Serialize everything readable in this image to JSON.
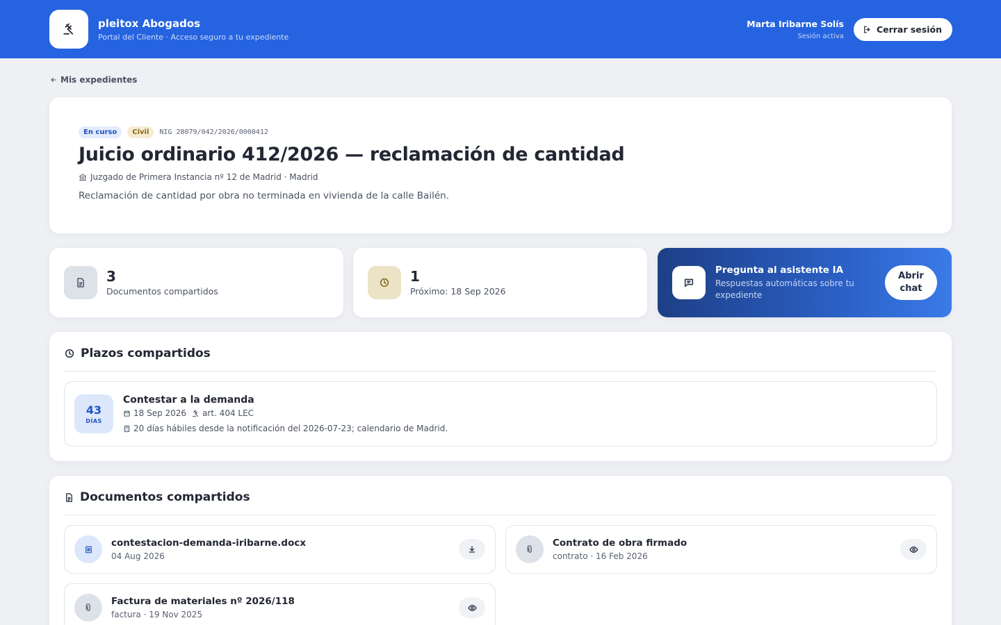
{
  "header": {
    "brand_name": "pleitox Abogados",
    "brand_subtitle": "Portal del Cliente · Acceso seguro a tu expediente",
    "user_name": "Marta Iribarne Solís",
    "user_status": "Sesión activa",
    "logout_label": "Cerrar sesión"
  },
  "breadcrumb": {
    "back_label": "Mis expedientes"
  },
  "case": {
    "status_tag": "En curso",
    "type_tag": "Civil",
    "nig": "NIG 28079/042/2026/0000412",
    "title": "Juicio ordinario 412/2026 — reclamación de cantidad",
    "court": "Juzgado de Primera Instancia nº 12 de Madrid · Madrid",
    "description": "Reclamación de cantidad por obra no terminada en vivienda de la calle Bailén."
  },
  "stats": {
    "documents": {
      "count": "3",
      "label": "Documentos compartidos"
    },
    "deadlines": {
      "count": "1",
      "label": "Próximo: 18 Sep 2026"
    }
  },
  "assistant": {
    "title": "Pregunta al asistente IA",
    "subtitle": "Respuestas automáticas sobre tu expediente",
    "button_line1": "Abrir",
    "button_line2": "chat"
  },
  "plazos": {
    "title": "Plazos compartidos",
    "items": [
      {
        "days": "43",
        "days_unit": "DÍAS",
        "title": "Contestar a la demanda",
        "date": "18 Sep 2026",
        "article": "art. 404 LEC",
        "note": "20 días hábiles desde la notificación del 2026-07-23; calendario de Madrid."
      }
    ]
  },
  "documentos": {
    "title": "Documentos compartidos",
    "items": [
      {
        "name": "contestacion-demanda-iribarne.docx",
        "meta": "04 Aug 2026",
        "action": "download-icon"
      },
      {
        "name": "Contrato de obra firmado",
        "meta": "contrato · 16 Feb 2026",
        "action": "eye-icon"
      },
      {
        "name": "Factura de materiales nº 2026/118",
        "meta": "factura · 19 Nov 2025",
        "action": "eye-icon"
      }
    ]
  },
  "colors": {
    "header_bg": "#2563e0",
    "accent": "#2154c6",
    "tag_status_bg": "#e3ecfd",
    "tag_type_bg": "#f6ecd2"
  }
}
